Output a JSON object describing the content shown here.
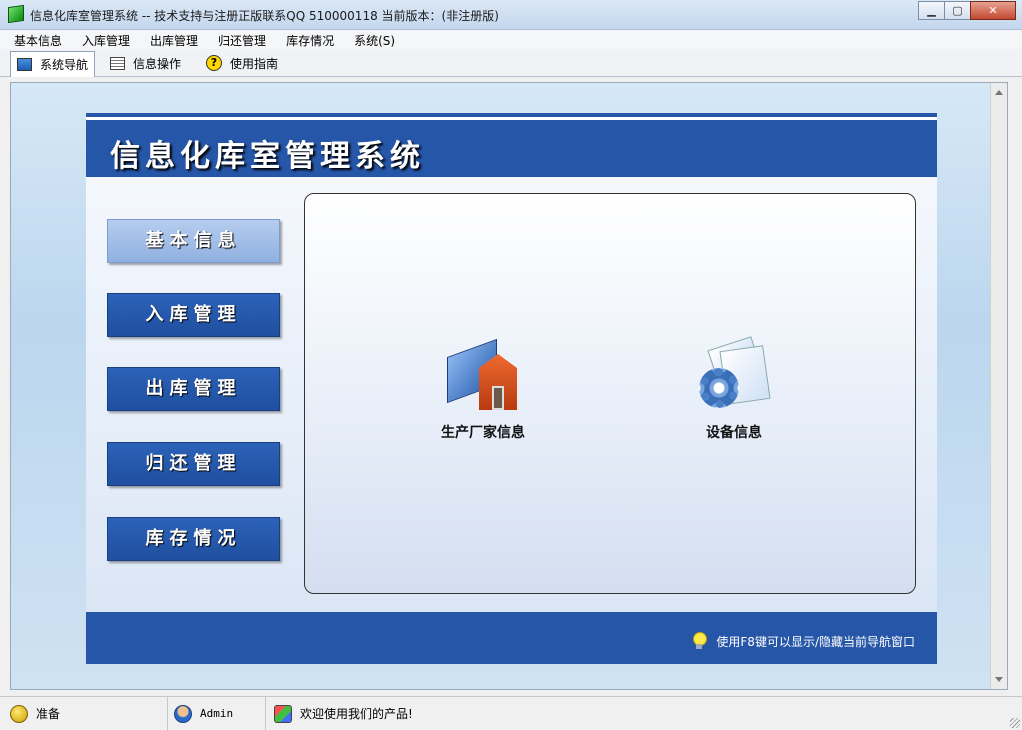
{
  "window": {
    "title": "信息化库室管理系统 -- 技术支持与注册正版联系QQ 510000118    当前版本：(非注册版)",
    "min_glyph": "▁",
    "max_glyph": "▢",
    "close_glyph": "✕"
  },
  "menu": {
    "items": [
      "基本信息",
      "入库管理",
      "出库管理",
      "归还管理",
      "库存情况",
      "系统(S)"
    ]
  },
  "toolbar": {
    "tabs": [
      {
        "label": "系统导航",
        "icon": "nav-window-icon"
      },
      {
        "label": "信息操作",
        "icon": "grid-icon"
      },
      {
        "label": "使用指南",
        "icon": "help-icon"
      }
    ],
    "help_glyph": "?"
  },
  "panel": {
    "title": "信息化库室管理系统",
    "nav_buttons": [
      "基本信息",
      "入库管理",
      "出库管理",
      "归还管理",
      "库存情况"
    ],
    "selected_nav": "基本信息",
    "items": [
      {
        "label": "生产厂家信息",
        "icon": "factory-icon"
      },
      {
        "label": "设备信息",
        "icon": "device-icon"
      }
    ],
    "footer_hint": "使用F8键可以显示/隐藏当前导航窗口"
  },
  "statusbar": {
    "ready": "准备",
    "user": "Admin",
    "welcome": "欢迎使用我们的产品!"
  },
  "colors": {
    "panel_blue": "#2656a8",
    "nav_selected": "#a9c2eb"
  }
}
